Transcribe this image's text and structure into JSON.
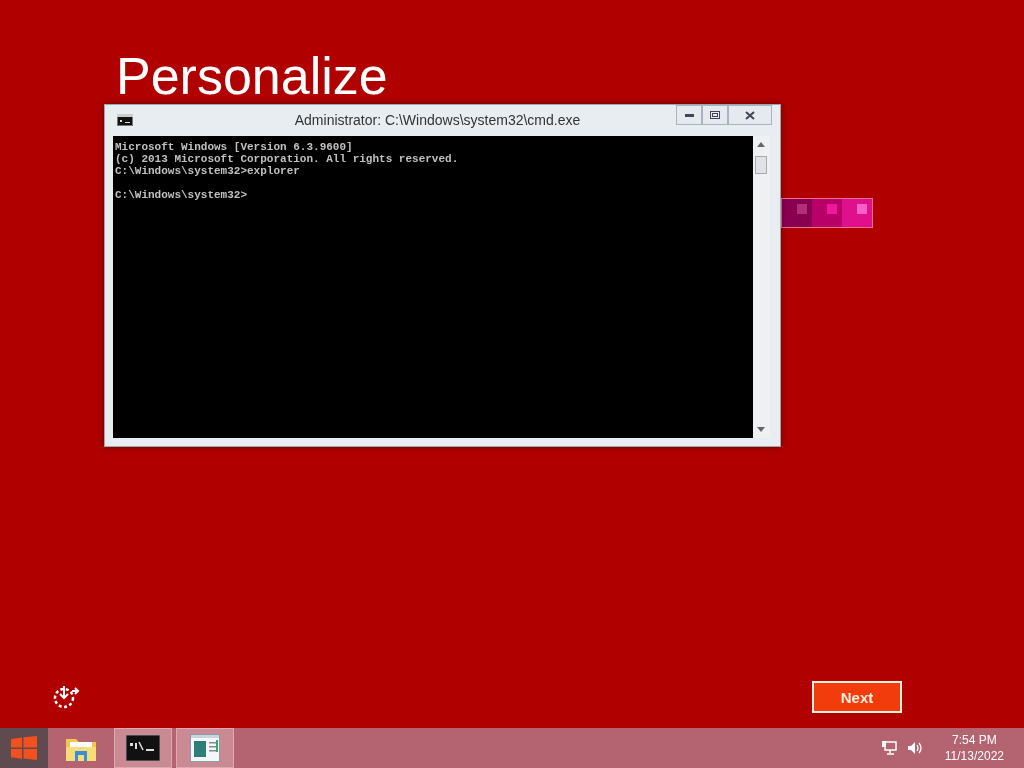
{
  "page": {
    "title": "Personalize"
  },
  "console_window": {
    "title": "Administrator: C:\\Windows\\system32\\cmd.exe",
    "lines": [
      "Microsoft Windows [Version 6.3.9600]",
      "(c) 2013 Microsoft Corporation. All rights reserved.",
      "C:\\Windows\\system32>explorer"
    ],
    "prompt": "C:\\Windows\\system32>"
  },
  "next_button": {
    "label": "Next"
  },
  "taskbar": {
    "apps": [
      {
        "kind": "folder",
        "running": false
      },
      {
        "kind": "console",
        "running": true
      },
      {
        "kind": "window",
        "running": true
      }
    ],
    "clock": {
      "time": "7:54 PM",
      "date": "11/13/2022"
    }
  }
}
